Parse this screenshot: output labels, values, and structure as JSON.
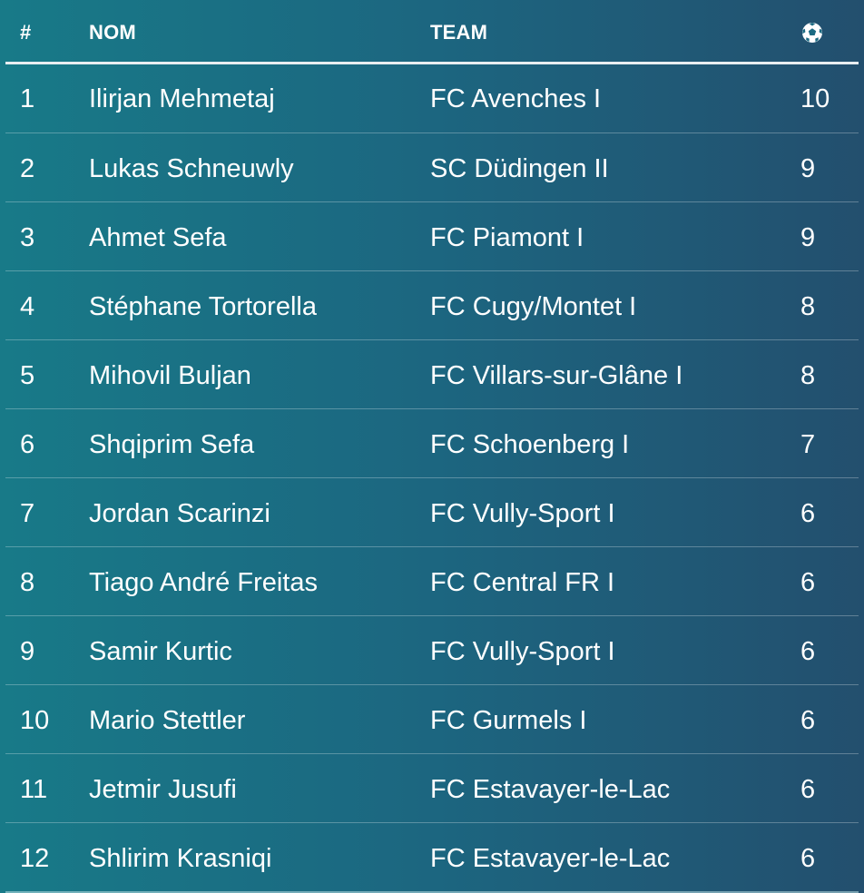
{
  "header": {
    "rank": "#",
    "name": "NOM",
    "team": "TEAM",
    "goals_icon": "soccer-ball-icon"
  },
  "rows": [
    {
      "rank": "1",
      "name": "Ilirjan Mehmetaj",
      "team": "FC Avenches I",
      "goals": "10"
    },
    {
      "rank": "2",
      "name": "Lukas Schneuwly",
      "team": "SC Düdingen II",
      "goals": "9"
    },
    {
      "rank": "3",
      "name": "Ahmet Sefa",
      "team": "FC Piamont I",
      "goals": "9"
    },
    {
      "rank": "4",
      "name": "Stéphane Tortorella",
      "team": "FC Cugy/Montet I",
      "goals": "8"
    },
    {
      "rank": "5",
      "name": "Mihovil Buljan",
      "team": "FC Villars-sur-Glâne I",
      "goals": "8"
    },
    {
      "rank": "6",
      "name": "Shqiprim Sefa",
      "team": "FC Schoenberg I",
      "goals": "7"
    },
    {
      "rank": "7",
      "name": "Jordan Scarinzi",
      "team": "FC Vully-Sport I",
      "goals": "6"
    },
    {
      "rank": "8",
      "name": "Tiago André Freitas",
      "team": "FC Central FR I",
      "goals": "6"
    },
    {
      "rank": "9",
      "name": "Samir Kurtic",
      "team": "FC Vully-Sport I",
      "goals": "6"
    },
    {
      "rank": "10",
      "name": "Mario Stettler",
      "team": "FC Gurmels I",
      "goals": "6"
    },
    {
      "rank": "11",
      "name": "Jetmir Jusufi",
      "team": "FC Estavayer-le-Lac",
      "goals": "6"
    },
    {
      "rank": "12",
      "name": "Shlirim Krasniqi",
      "team": "FC Estavayer-le-Lac",
      "goals": "6"
    }
  ],
  "colors": {
    "background_left": "#187a88",
    "background_right": "#234f6e",
    "text": "#ffffff"
  }
}
